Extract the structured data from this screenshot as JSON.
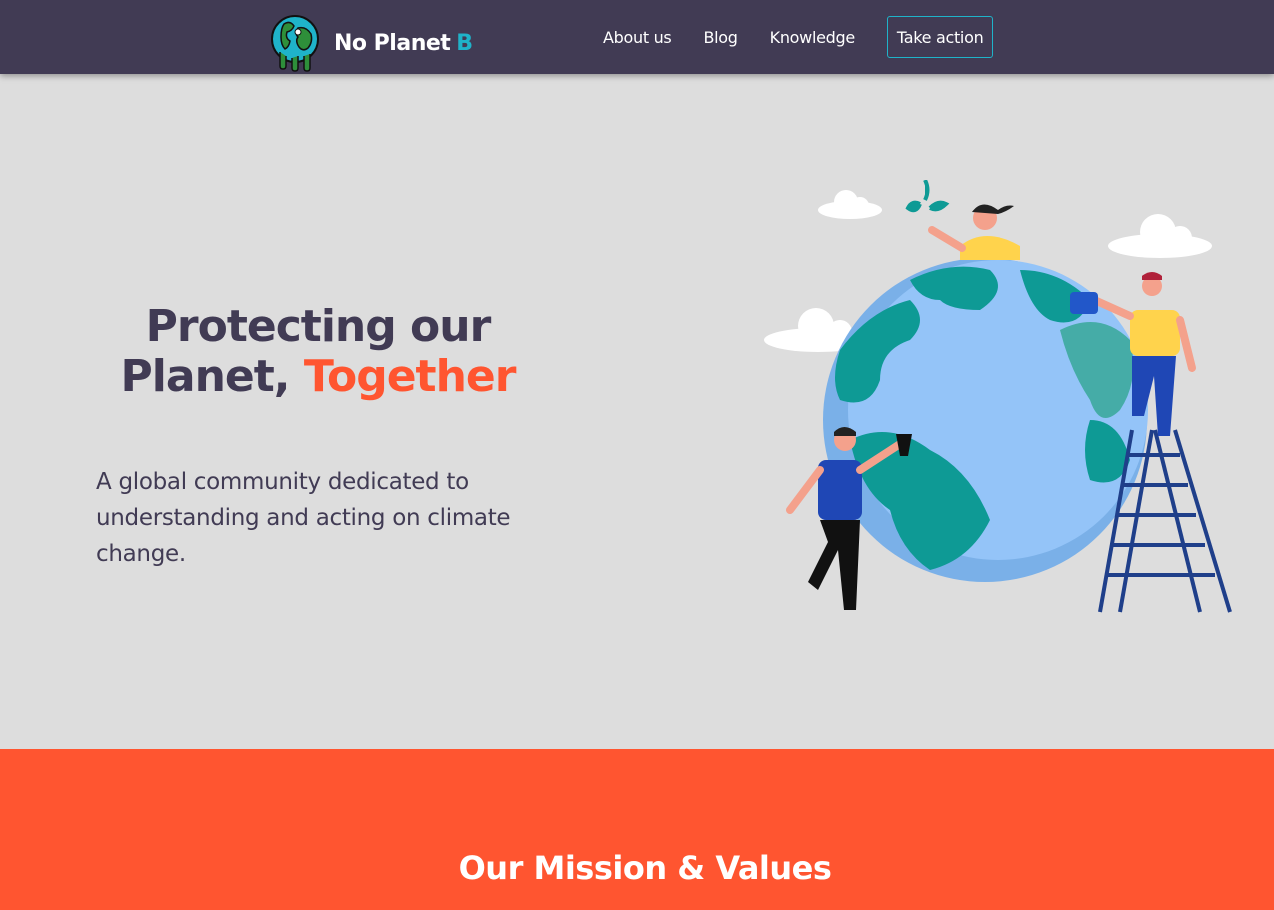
{
  "nav": {
    "brand": "No Planet",
    "brand_suffix": "B",
    "links": [
      "About us",
      "Blog",
      "Knowledge"
    ],
    "cta": "Take action"
  },
  "hero": {
    "title_line1": "Protecting our",
    "title_line2_start": "Planet,",
    "title_accent": "Together",
    "subtitle": "A global community dedicated to understanding and acting on climate change."
  },
  "mission": {
    "title": "Our Mission & Values"
  },
  "colors": {
    "nav_bg": "#413b54",
    "accent_orange": "#ff5530",
    "accent_teal": "#1fb3c9",
    "hero_bg": "#dddddd",
    "text_dark": "#413b54"
  },
  "icons": [
    "earth-logo-icon",
    "globe-illustration"
  ]
}
